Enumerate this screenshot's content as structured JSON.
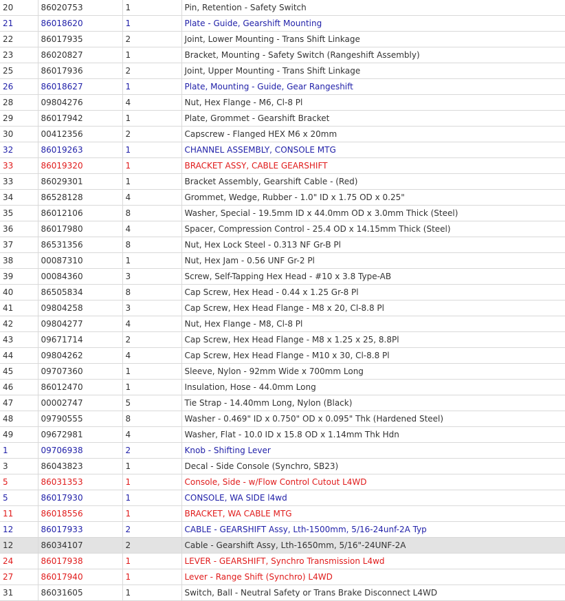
{
  "colors": {
    "text": "#333333",
    "blue": "#1f1fa8",
    "red": "#e01b1b",
    "highlight": "#e3e3e3",
    "border": "#d9d9d9"
  },
  "rows": [
    {
      "ref": "20",
      "part": "86020753",
      "qty": "1",
      "desc": "Pin, Retention - Safety Switch",
      "style": "normal"
    },
    {
      "ref": "21",
      "part": "86018620",
      "qty": "1",
      "desc": "Plate - Guide, Gearshift Mounting",
      "style": "blue"
    },
    {
      "ref": "22",
      "part": "86017935",
      "qty": "2",
      "desc": "Joint, Lower Mounting - Trans Shift Linkage",
      "style": "normal"
    },
    {
      "ref": "23",
      "part": "86020827",
      "qty": "1",
      "desc": "Bracket, Mounting - Safety Switch (Rangeshift Assembly)",
      "style": "normal"
    },
    {
      "ref": "25",
      "part": "86017936",
      "qty": "2",
      "desc": "Joint, Upper Mounting - Trans Shift Linkage",
      "style": "normal"
    },
    {
      "ref": "26",
      "part": "86018627",
      "qty": "1",
      "desc": "Plate, Mounting - Guide, Gear Rangeshift",
      "style": "blue"
    },
    {
      "ref": "28",
      "part": "09804276",
      "qty": "4",
      "desc": "Nut, Hex Flange - M6, Cl-8 Pl",
      "style": "normal"
    },
    {
      "ref": "29",
      "part": "86017942",
      "qty": "1",
      "desc": "Plate, Grommet - Gearshift Bracket",
      "style": "normal"
    },
    {
      "ref": "30",
      "part": "00412356",
      "qty": "2",
      "desc": "Capscrew - Flanged HEX M6 x 20mm",
      "style": "normal"
    },
    {
      "ref": "32",
      "part": "86019263",
      "qty": "1",
      "desc": "CHANNEL ASSEMBLY, CONSOLE MTG",
      "style": "blue"
    },
    {
      "ref": "33",
      "part": "86019320",
      "qty": "1",
      "desc": "BRACKET ASSY, CABLE GEARSHIFT",
      "style": "red"
    },
    {
      "ref": "33",
      "part": "86029301",
      "qty": "1",
      "desc": "Bracket Assembly, Gearshift Cable - (Red)",
      "style": "normal"
    },
    {
      "ref": "34",
      "part": "86528128",
      "qty": "4",
      "desc": "Grommet, Wedge, Rubber - 1.0\" ID x 1.75 OD x 0.25\"",
      "style": "normal"
    },
    {
      "ref": "35",
      "part": "86012106",
      "qty": "8",
      "desc": "Washer, Special - 19.5mm ID x 44.0mm OD x 3.0mm Thick (Steel)",
      "style": "normal"
    },
    {
      "ref": "36",
      "part": "86017980",
      "qty": "4",
      "desc": "Spacer, Compression Control - 25.4 OD x 14.15mm Thick (Steel)",
      "style": "normal"
    },
    {
      "ref": "37",
      "part": "86531356",
      "qty": "8",
      "desc": "Nut, Hex Lock Steel - 0.313 NF Gr-B Pl",
      "style": "normal"
    },
    {
      "ref": "38",
      "part": "00087310",
      "qty": "1",
      "desc": "Nut, Hex Jam - 0.56 UNF Gr-2 Pl",
      "style": "normal"
    },
    {
      "ref": "39",
      "part": "00084360",
      "qty": "3",
      "desc": "Screw, Self-Tapping Hex Head - #10 x 3.8 Type-AB",
      "style": "normal"
    },
    {
      "ref": "40",
      "part": "86505834",
      "qty": "8",
      "desc": "Cap Screw, Hex Head - 0.44 x 1.25 Gr-8 Pl",
      "style": "normal"
    },
    {
      "ref": "41",
      "part": "09804258",
      "qty": "3",
      "desc": "Cap Screw, Hex Head Flange - M8 x 20, Cl-8.8 Pl",
      "style": "normal"
    },
    {
      "ref": "42",
      "part": "09804277",
      "qty": "4",
      "desc": "Nut, Hex Flange - M8, Cl-8 Pl",
      "style": "normal"
    },
    {
      "ref": "43",
      "part": "09671714",
      "qty": "2",
      "desc": "Cap Screw, Hex Head Flange - M8 x 1.25 x 25, 8.8Pl",
      "style": "normal"
    },
    {
      "ref": "44",
      "part": "09804262",
      "qty": "4",
      "desc": "Cap Screw, Hex Head Flange - M10 x 30, Cl-8.8 Pl",
      "style": "normal"
    },
    {
      "ref": "45",
      "part": "09707360",
      "qty": "1",
      "desc": "Sleeve, Nylon - 92mm Wide x 700mm Long",
      "style": "normal"
    },
    {
      "ref": "46",
      "part": "86012470",
      "qty": "1",
      "desc": "Insulation, Hose - 44.0mm Long",
      "style": "normal"
    },
    {
      "ref": "47",
      "part": "00002747",
      "qty": "5",
      "desc": "Tie Strap - 14.40mm Long, Nylon (Black)",
      "style": "normal"
    },
    {
      "ref": "48",
      "part": "09790555",
      "qty": "8",
      "desc": "Washer - 0.469\" ID x 0.750\" OD x 0.095\" Thk (Hardened Steel)",
      "style": "normal"
    },
    {
      "ref": "49",
      "part": "09672981",
      "qty": "4",
      "desc": "Washer, Flat - 10.0 ID x 15.8 OD x 1.14mm Thk Hdn",
      "style": "normal"
    },
    {
      "ref": "1",
      "part": "09706938",
      "qty": "2",
      "desc": "Knob - Shifting Lever",
      "style": "blue"
    },
    {
      "ref": "3",
      "part": "86043823",
      "qty": "1",
      "desc": "Decal - Side Console (Synchro, SB23)",
      "style": "normal"
    },
    {
      "ref": "5",
      "part": "86031353",
      "qty": "1",
      "desc": "Console, Side - w/Flow Control Cutout L4WD",
      "style": "red"
    },
    {
      "ref": "5",
      "part": "86017930",
      "qty": "1",
      "desc": "CONSOLE, WA SIDE l4wd",
      "style": "blue"
    },
    {
      "ref": "11",
      "part": "86018556",
      "qty": "1",
      "desc": "BRACKET, WA CABLE MTG",
      "style": "red"
    },
    {
      "ref": "12",
      "part": "86017933",
      "qty": "2",
      "desc": "CABLE - GEARSHIFT Assy, Lth-1500mm, 5/16-24unf-2A Typ",
      "style": "blue"
    },
    {
      "ref": "12",
      "part": "86034107",
      "qty": "2",
      "desc": "Cable - Gearshift Assy, Lth-1650mm, 5/16\"-24UNF-2A",
      "style": "hl"
    },
    {
      "ref": "24",
      "part": "86017938",
      "qty": "1",
      "desc": "LEVER - GEARSHIFT, Synchro Transmission L4wd",
      "style": "red"
    },
    {
      "ref": "27",
      "part": "86017940",
      "qty": "1",
      "desc": "Lever - Range Shift (Synchro) L4WD",
      "style": "red"
    },
    {
      "ref": "31",
      "part": "86031605",
      "qty": "1",
      "desc": "Switch, Ball - Neutral Safety or Trans Brake Disconnect L4WD",
      "style": "normal"
    }
  ]
}
